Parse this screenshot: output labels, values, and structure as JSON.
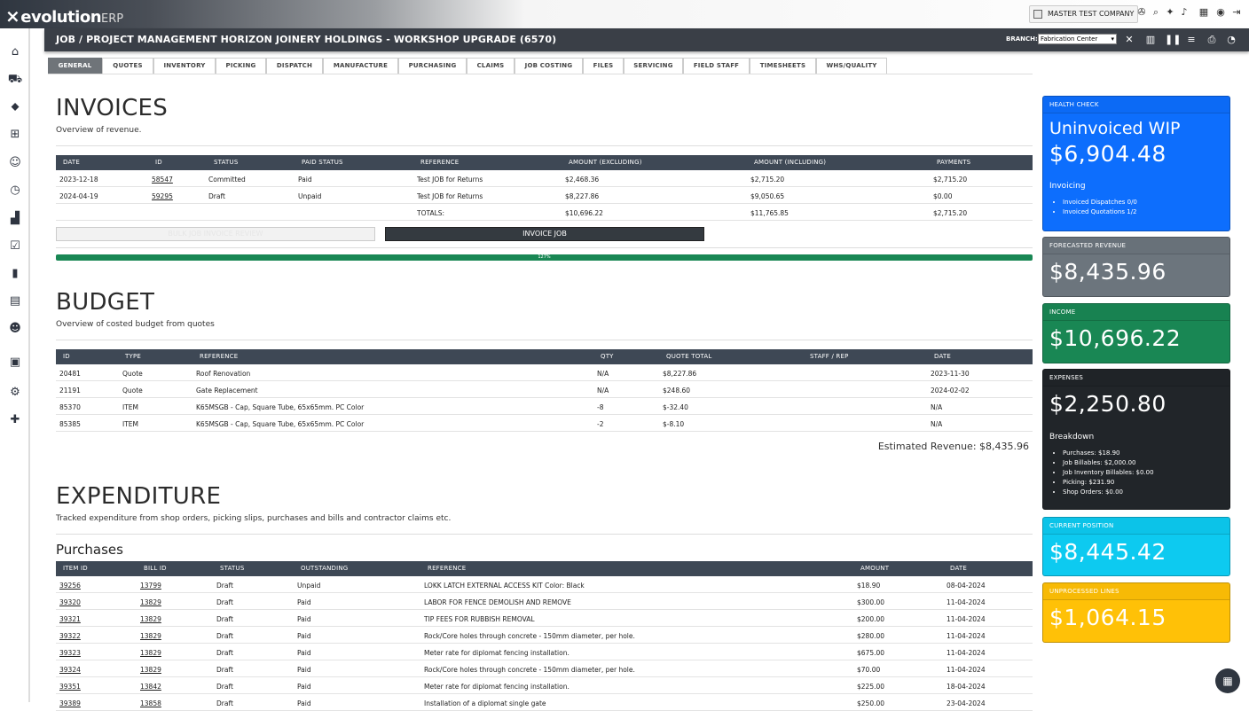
{
  "app": {
    "logo_main": "evolution",
    "logo_suffix": "ERP",
    "company": "MASTER TEST COMPANY"
  },
  "job": {
    "title": "JOB / PROJECT MANAGEMENT HORIZON JOINERY HOLDINGS - WORKSHOP UPGRADE (6570)",
    "branch_label": "BRANCH:",
    "branch_value": "Fabrication Center"
  },
  "tabs": [
    "GENERAL",
    "QUOTES",
    "INVENTORY",
    "PICKING",
    "DISPATCH",
    "MANUFACTURE",
    "PURCHASING",
    "CLAIMS",
    "JOB COSTING",
    "FILES",
    "SERVICING",
    "FIELD STAFF",
    "TIMESHEETS",
    "WHS/QUALITY"
  ],
  "invoices": {
    "title": "INVOICES",
    "subtitle": "Overview of revenue.",
    "headers": [
      "DATE",
      "ID",
      "STATUS",
      "PAID STATUS",
      "REFERENCE",
      "AMOUNT (EXCLUDING)",
      "AMOUNT (INCLUDING)",
      "PAYMENTS"
    ],
    "rows": [
      [
        "2023-12-18",
        "58547",
        "Committed",
        "Paid",
        "Test JOB for Returns",
        "$2,468.36",
        "$2,715.20",
        "$2,715.20"
      ],
      [
        "2024-04-19",
        "59295",
        "Draft",
        "Unpaid",
        "Test JOB for Returns",
        "$8,227.86",
        "$9,050.65",
        "$0.00"
      ]
    ],
    "totals": {
      "label": "TOTALS:",
      "excl": "$10,696.22",
      "incl": "$11,765.85",
      "payments": "$2,715.20"
    },
    "bulk_button": "BULK JOB INVOICE REVIEW",
    "invoice_button": "INVOICE JOB",
    "progress_label": "127%",
    "progress_value": 1.0
  },
  "budget": {
    "title": "BUDGET",
    "subtitle": "Overview of costed budget from quotes",
    "headers": [
      "ID",
      "TYPE",
      "REFERENCE",
      "QTY",
      "QUOTE TOTAL",
      "STAFF / REP",
      "DATE"
    ],
    "rows": [
      [
        "20481",
        "Quote",
        "Roof Renovation",
        "N/A",
        "$8,227.86",
        "",
        "2023-11-30"
      ],
      [
        "21191",
        "Quote",
        "Gate Replacement",
        "N/A",
        "$248.60",
        "",
        "2024-02-02"
      ],
      [
        "85370",
        "ITEM",
        "K65MSGB - Cap, Square Tube, 65x65mm. PC Color",
        "-8",
        "$-32.40",
        "",
        "N/A"
      ],
      [
        "85385",
        "ITEM",
        "K65MSGB - Cap, Square Tube, 65x65mm. PC Color",
        "-2",
        "$-8.10",
        "",
        "N/A"
      ]
    ],
    "estimated_revenue": "Estimated Revenue: $8,435.96"
  },
  "expenditure": {
    "title": "EXPENDITURE",
    "subtitle": "Tracked expenditure from shop orders, picking slips, purchases and bills and contractor claims etc.",
    "purchases_title": "Purchases",
    "headers": [
      "ITEM ID",
      "BILL ID",
      "STATUS",
      "OUTSTANDING",
      "REFERENCE",
      "AMOUNT",
      "DATE"
    ],
    "rows": [
      [
        "39256",
        "13799",
        "Draft",
        "Unpaid",
        "LOKK LATCH EXTERNAL ACCESS KIT Color: Black",
        "$18.90",
        "08-04-2024"
      ],
      [
        "39320",
        "13829",
        "Draft",
        "Paid",
        "LABOR FOR FENCE DEMOLISH AND REMOVE",
        "$300.00",
        "11-04-2024"
      ],
      [
        "39321",
        "13829",
        "Draft",
        "Paid",
        "TIP FEES FOR RUBBISH REMOVAL",
        "$200.00",
        "11-04-2024"
      ],
      [
        "39322",
        "13829",
        "Draft",
        "Paid",
        "Rock/Core holes through concrete - 150mm diameter, per hole.",
        "$280.00",
        "11-04-2024"
      ],
      [
        "39323",
        "13829",
        "Draft",
        "Paid",
        "Meter rate for diplomat fencing installation.",
        "$675.00",
        "11-04-2024"
      ],
      [
        "39324",
        "13829",
        "Draft",
        "Paid",
        "Rock/Core holes through concrete - 150mm diameter, per hole.",
        "$70.00",
        "11-04-2024"
      ],
      [
        "39351",
        "13842",
        "Draft",
        "Paid",
        "Meter rate for diplomat fencing installation.",
        "$225.00",
        "18-04-2024"
      ],
      [
        "39389",
        "13858",
        "Draft",
        "Paid",
        "Installation of a diplomat single gate",
        "$250.00",
        "23-04-2024"
      ]
    ]
  },
  "cards": {
    "health": {
      "header": "HEALTH CHECK",
      "title": "Uninvoiced WIP",
      "value": "$6,904.48",
      "section": "Invoicing",
      "items": [
        "Invoiced Dispatches 0/0",
        "Invoiced Quotations 1/2"
      ],
      "color": "#0d6efd"
    },
    "forecast": {
      "header": "FORECASTED REVENUE",
      "value": "$8,435.96",
      "color": "#6c757d"
    },
    "income": {
      "header": "INCOME",
      "value": "$10,696.22",
      "color": "#198754"
    },
    "expenses": {
      "header": "EXPENSES",
      "value": "$2,250.80",
      "section": "Breakdown",
      "items": [
        "Purchases: $18.90",
        "Job Billables: $2,000.00",
        "Job Inventory Billables: $0.00",
        "Picking: $231.90",
        "Shop Orders: $0.00"
      ],
      "color": "#212529"
    },
    "position": {
      "header": "CURRENT POSITION",
      "value": "$8,445.42",
      "color": "#0dcaf0"
    },
    "unprocessed": {
      "header": "UNPROCESSED LINES",
      "value": "$1,064.15",
      "color": "#ffc107"
    }
  }
}
